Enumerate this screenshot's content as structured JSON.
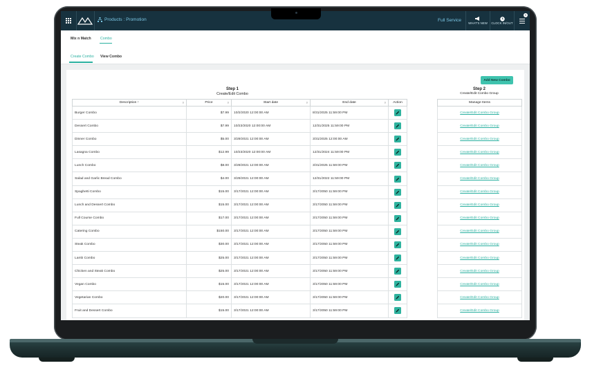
{
  "topbar": {
    "breadcrumb": "Products : Promotion",
    "service": "Full Service",
    "whats_new": "WHAT'S NEW",
    "clock": "CLOCK IN/OUT",
    "badge": "0"
  },
  "subnav": {
    "items": [
      "Mix n Match",
      "Combo"
    ]
  },
  "tabs": {
    "items": [
      "Create Combo",
      "View Combo"
    ]
  },
  "add_button": "Add New Combo",
  "step1": {
    "title": "Step 1",
    "subtitle": "Create/Edit Combo"
  },
  "step2": {
    "title": "Step 2",
    "subtitle": "Create/Edit Combo Group"
  },
  "columns": {
    "description": "Description ↑",
    "price": "Price",
    "start": "Start date",
    "end": "End date",
    "action": "Action",
    "manage": "Manage Items"
  },
  "link_label": "Create/Edit Combo Group",
  "rows": [
    {
      "description": "Burger Combo",
      "price": "$7.99",
      "start": "10/2/2020 12:00:00 AM",
      "end": "8/31/2025 11:59:00 PM"
    },
    {
      "description": "Dessert Combo",
      "price": "$7.99",
      "start": "10/23/2020 12:00:00 AM",
      "end": "12/31/2025 11:59:00 PM"
    },
    {
      "description": "Dinner Combo",
      "price": "$5.00",
      "start": "3/29/2021 12:00:00 AM",
      "end": "3/31/2025 12:00:00 AM"
    },
    {
      "description": "Lasagna Combo",
      "price": "$12.99",
      "start": "10/23/2020 12:00:00 AM",
      "end": "12/31/2024 11:59:00 PM"
    },
    {
      "description": "Lunch Combo",
      "price": "$8.00",
      "start": "3/29/2021 12:00:00 AM",
      "end": "3/31/2025 11:59:00 PM"
    },
    {
      "description": "Salad and Garlic Bread Combo",
      "price": "$4.00",
      "start": "3/29/2021 12:00:00 AM",
      "end": "12/31/2022 11:59:00 PM"
    },
    {
      "description": "Spaghetti Combo",
      "price": "$15.00",
      "start": "3/17/2021 12:00:00 AM",
      "end": "3/17/2050 11:59:00 PM"
    },
    {
      "description": "Lunch and Dessert Combo",
      "price": "$15.00",
      "start": "3/17/2021 12:00:00 AM",
      "end": "3/17/2050 11:59:00 PM"
    },
    {
      "description": "Full Course Combo",
      "price": "$17.00",
      "start": "3/17/2021 12:00:00 AM",
      "end": "3/17/2050 11:59:00 PM"
    },
    {
      "description": "Catering Combo",
      "price": "$150.00",
      "start": "3/17/2021 12:00:00 AM",
      "end": "3/17/2050 11:59:00 PM"
    },
    {
      "description": "Steak Combo",
      "price": "$30.00",
      "start": "3/17/2021 12:00:00 AM",
      "end": "3/17/2050 11:59:00 PM"
    },
    {
      "description": "Lamb Combo",
      "price": "$25.00",
      "start": "3/17/2021 12:00:00 AM",
      "end": "3/17/2050 11:59:00 PM"
    },
    {
      "description": "Chicken and Steak Combo",
      "price": "$25.00",
      "start": "3/17/2021 12:00:00 AM",
      "end": "3/17/2050 11:59:00 PM"
    },
    {
      "description": "Vegan Combo",
      "price": "$15.00",
      "start": "3/17/2021 12:00:00 AM",
      "end": "3/17/2050 11:59:00 PM"
    },
    {
      "description": "Vegetarian Combo",
      "price": "$20.00",
      "start": "3/17/2021 12:00:00 AM",
      "end": "3/17/2050 11:59:00 PM"
    },
    {
      "description": "Fruit and Dessert Combo",
      "price": "$15.00",
      "start": "3/17/2021 12:00:00 AM",
      "end": "3/17/2050 11:59:00 PM"
    }
  ],
  "colors": {
    "accent": "#2ab0a0",
    "topbar": "#17323f",
    "button": "#3fc3ae"
  }
}
